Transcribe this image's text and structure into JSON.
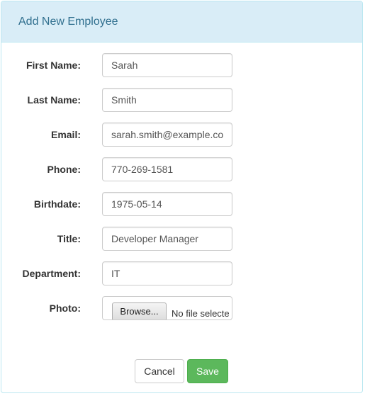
{
  "header": {
    "title": "Add New Employee"
  },
  "form": {
    "first_name": {
      "label": "First Name:",
      "value": "Sarah"
    },
    "last_name": {
      "label": "Last Name:",
      "value": "Smith"
    },
    "email": {
      "label": "Email:",
      "value": "sarah.smith@example.co"
    },
    "phone": {
      "label": "Phone:",
      "value": "770-269-1581"
    },
    "birthdate": {
      "label": "Birthdate:",
      "value": "1975-05-14"
    },
    "title": {
      "label": "Title:",
      "value": "Developer Manager"
    },
    "department": {
      "label": "Department:",
      "value": "IT"
    },
    "photo": {
      "label": "Photo:",
      "browse_label": "Browse...",
      "status": "No file selecte"
    }
  },
  "actions": {
    "cancel_label": "Cancel",
    "save_label": "Save"
  },
  "colors": {
    "heading_bg": "#d9edf7",
    "heading_text": "#31708f",
    "panel_border": "#bce8f1",
    "save_button": "#5cb85c"
  }
}
